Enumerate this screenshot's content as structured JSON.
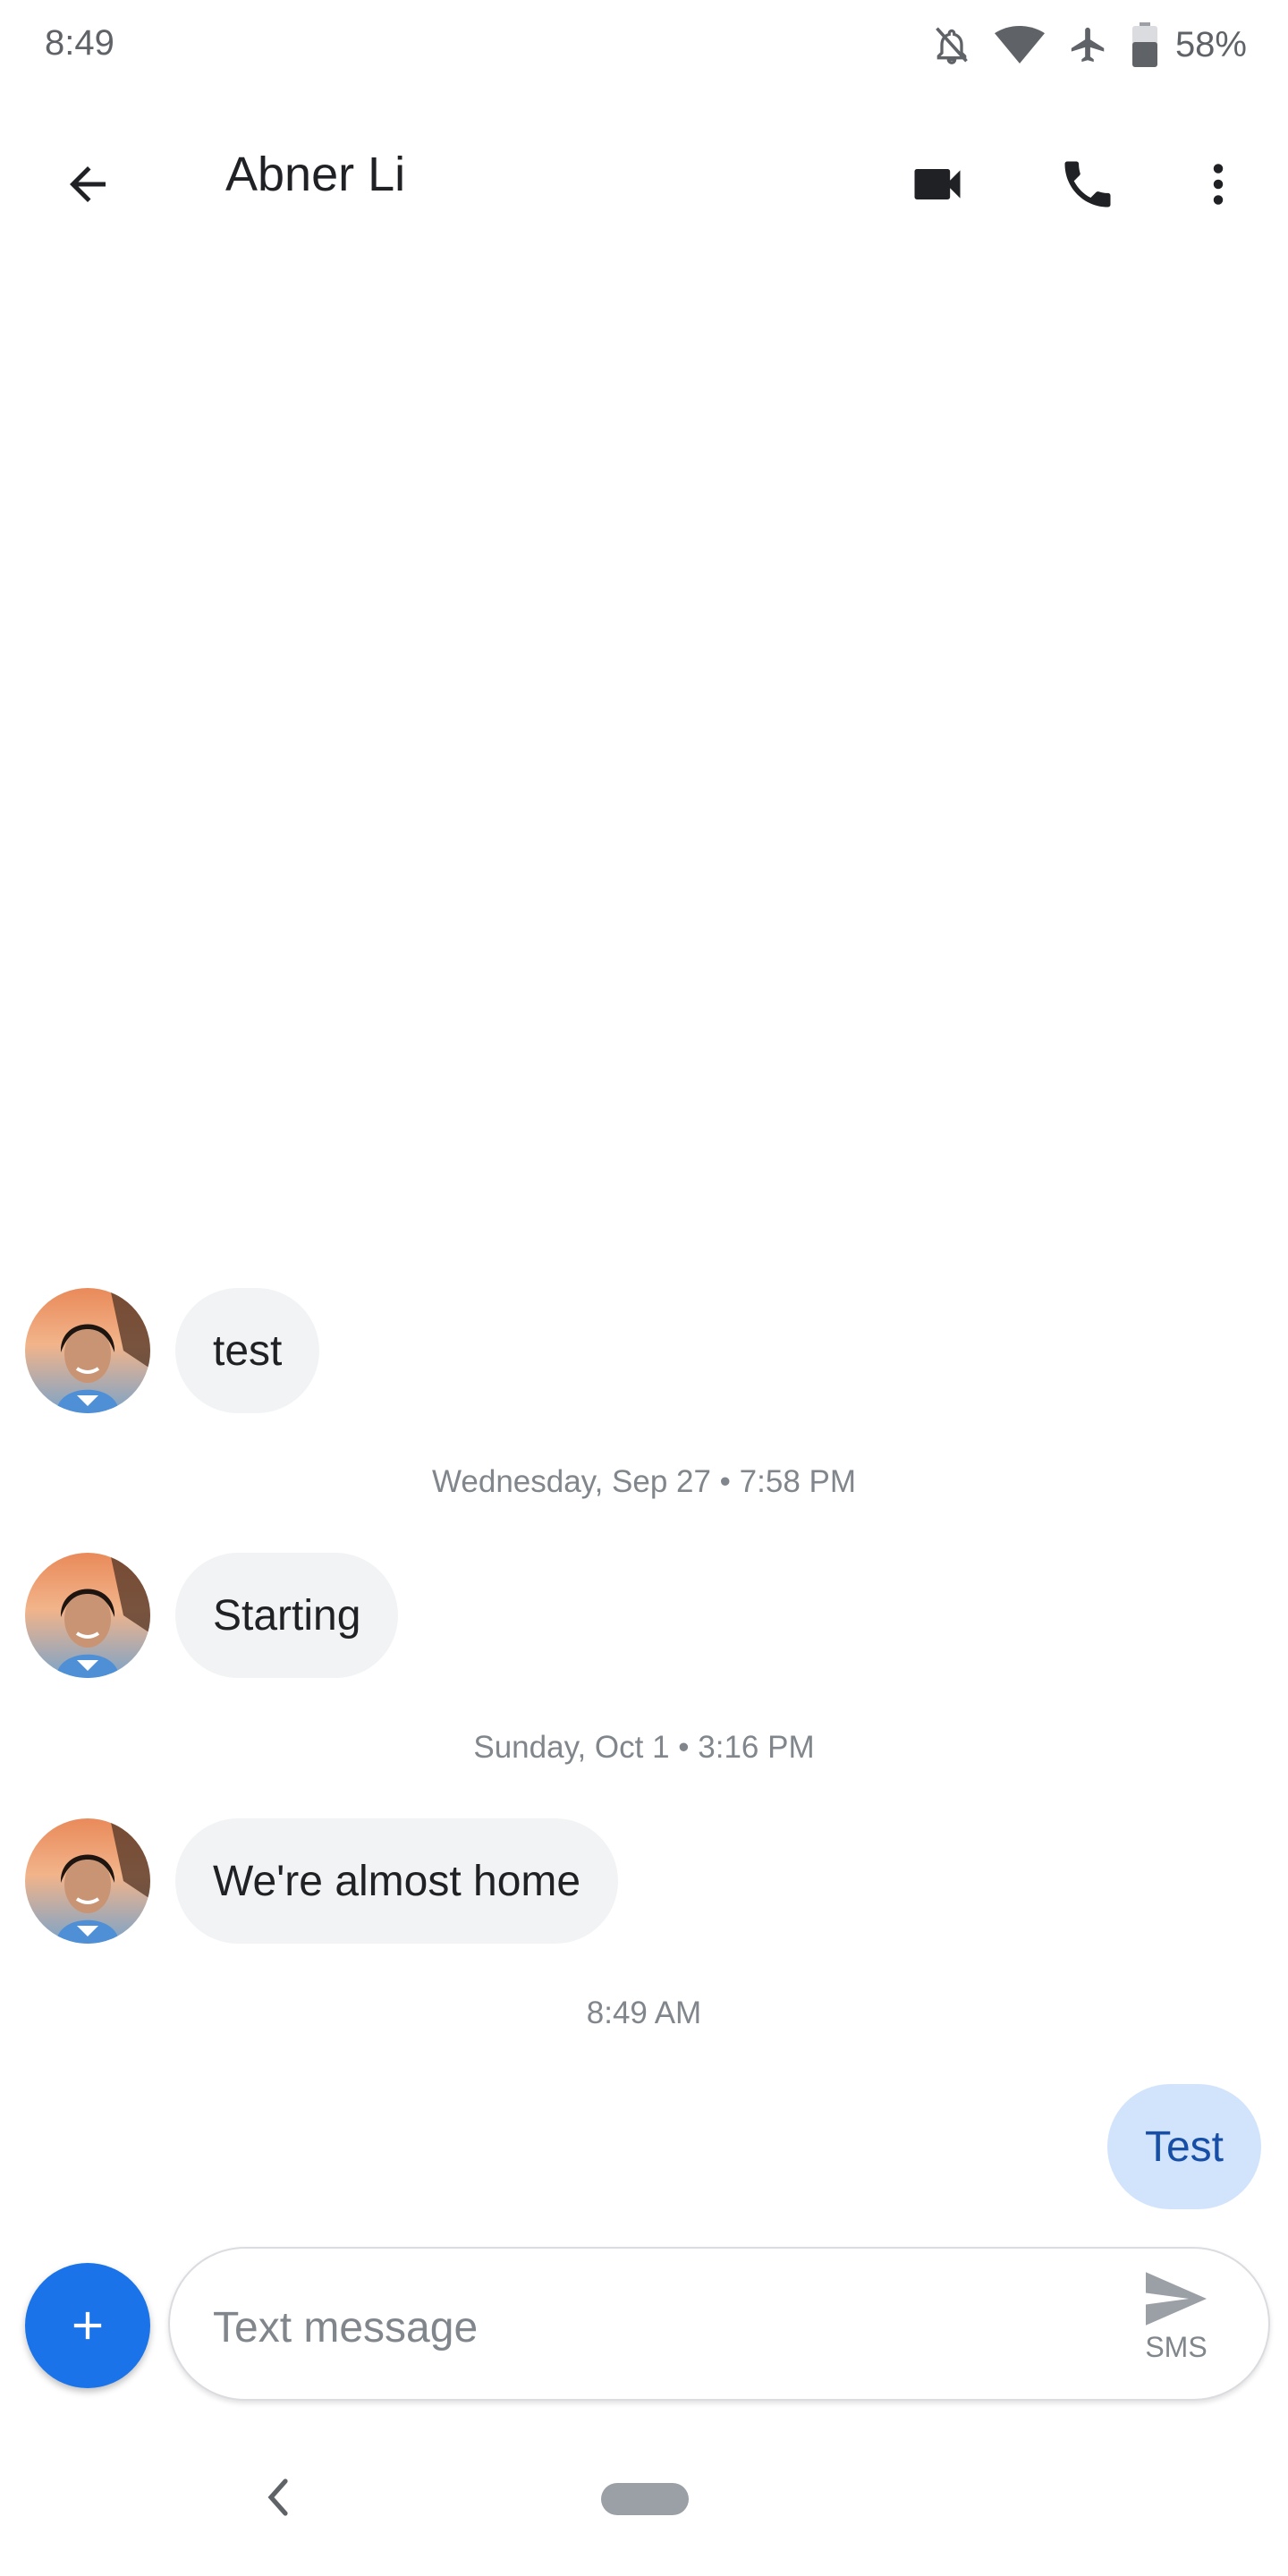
{
  "status_bar": {
    "time": "8:49",
    "battery_percent": "58%",
    "icons": [
      "notifications-off-icon",
      "wifi-icon",
      "airplane-mode-icon",
      "battery-icon"
    ]
  },
  "app_bar": {
    "contact_name": "Abner Li",
    "icons": [
      "back-arrow-icon",
      "video-call-icon",
      "phone-icon",
      "more-vert-icon"
    ]
  },
  "conversation": {
    "incoming": [
      {
        "text": "test"
      },
      {
        "text": "Starting"
      },
      {
        "text": "We're almost home"
      }
    ],
    "timestamps": [
      "Wednesday, Sep 27 • 7:58 PM",
      "Sunday, Oct 1 • 3:16 PM",
      "8:49 AM"
    ],
    "outgoing": [
      {
        "text": "Test"
      }
    ]
  },
  "compose": {
    "placeholder": "Text message",
    "value": "",
    "send_label": "SMS"
  },
  "colors": {
    "accent": "#1a73e8",
    "incoming_bubble": "#f1f3f4",
    "outgoing_bubble": "#d2e3fc",
    "outgoing_text": "#174ea6"
  }
}
